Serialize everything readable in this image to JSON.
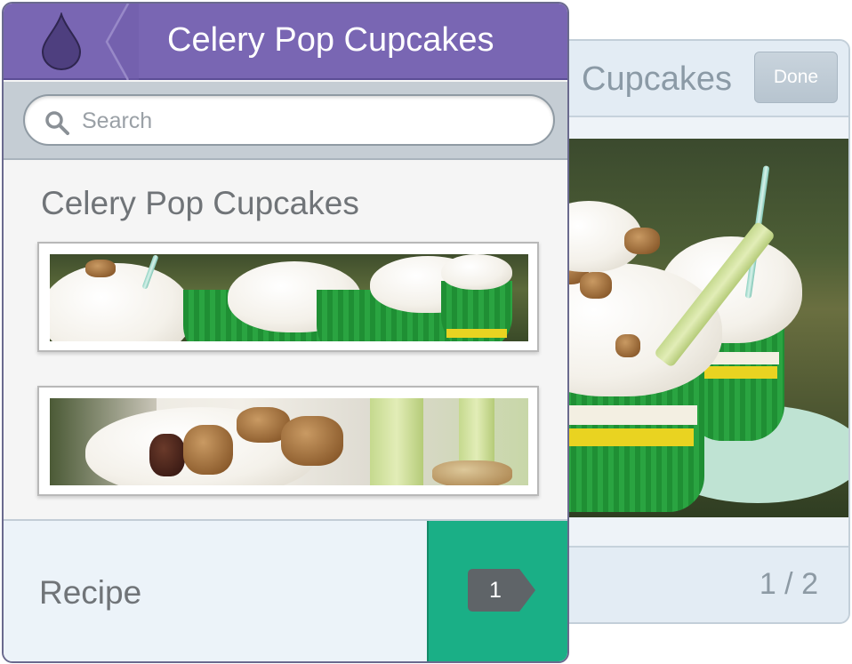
{
  "detail": {
    "title": "Cupcakes",
    "done_label": "Done",
    "page_counter": "1 / 2"
  },
  "list": {
    "header_title": "Celery Pop Cupcakes",
    "search_placeholder": "Search",
    "section_title": "Celery Pop Cupcakes",
    "footer_label": "Recipe",
    "footer_count": "1"
  },
  "icons": {
    "app_logo": "drop-icon",
    "back": "chevron-left-icon",
    "search": "search-icon",
    "count_badge": "tag-icon"
  },
  "colors": {
    "header_purple": "#7966b3",
    "accent_green": "#1aaf86",
    "badge_gray": "#5f6468"
  }
}
